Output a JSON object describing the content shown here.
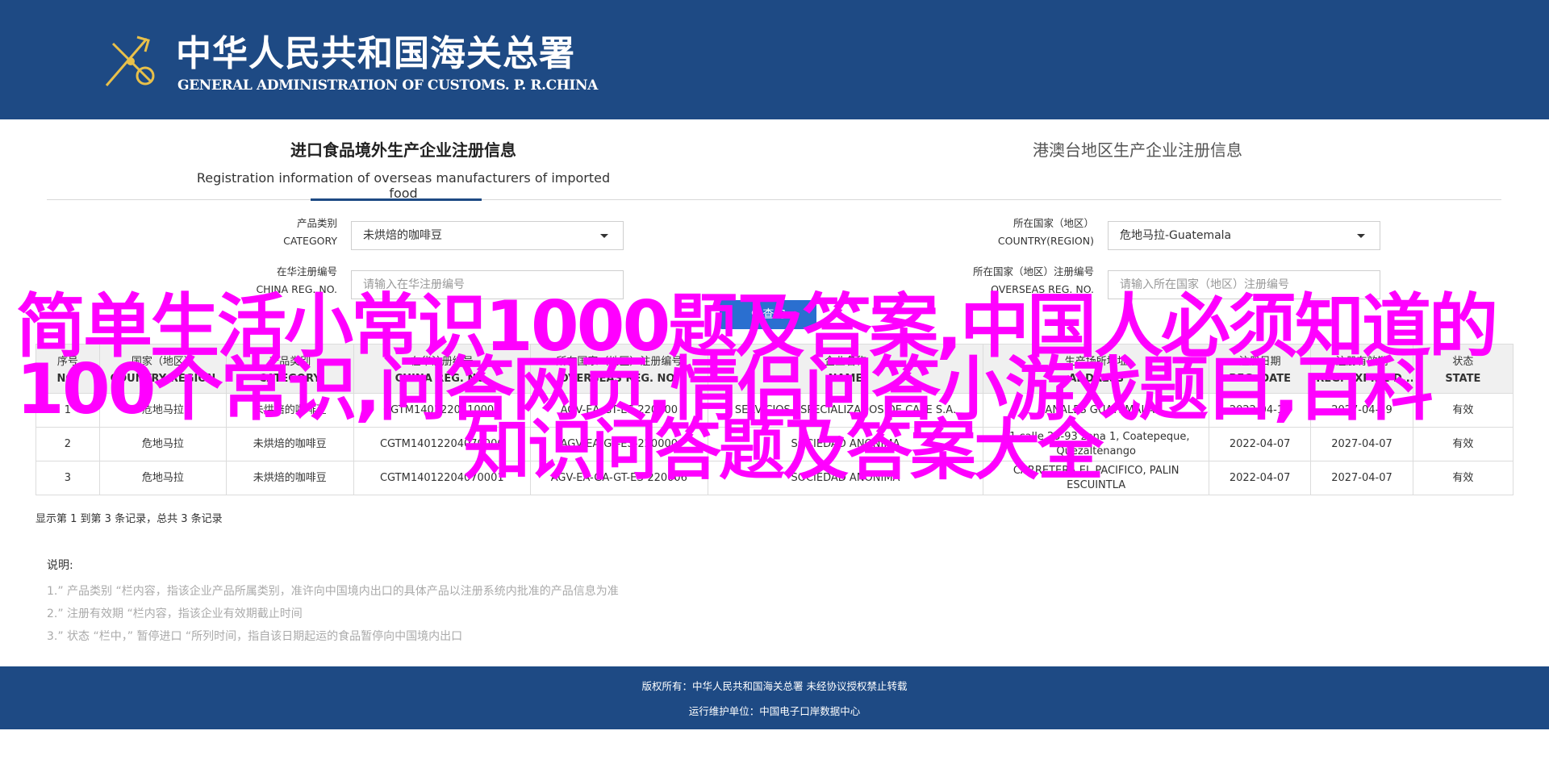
{
  "header": {
    "title_cn": "中华人民共和国海关总署",
    "title_en": "GENERAL ADMINISTRATION OF CUSTOMS. P. R.CHINA"
  },
  "tabs": {
    "active_cn": "进口食品境外生产企业注册信息",
    "active_en": "Registration information of overseas manufacturers of imported food",
    "other_cn": "港澳台地区生产企业注册信息"
  },
  "filters": {
    "category_label_cn": "产品类别",
    "category_label_en": "CATEGORY",
    "category_value": "未烘焙的咖啡豆",
    "country_label_cn": "所在国家（地区）",
    "country_label_en": "COUNTRY(REGION)",
    "country_value": "危地马拉-Guatemala",
    "china_reg_label_cn": "在华注册编号",
    "china_reg_label_en": "CHINA REG. NO.",
    "china_reg_placeholder": "请输入在华注册编号",
    "overseas_reg_label_cn": "所在国家（地区）注册编号",
    "overseas_reg_label_en": "OVERSEAS REG. NO.",
    "overseas_reg_placeholder": "请输入所在国家（地区）注册编号",
    "search_label": "查询"
  },
  "table": {
    "headers": [
      {
        "cn": "序号",
        "en": "NO."
      },
      {
        "cn": "国家（地区）",
        "en": "COUNTRY/REGION"
      },
      {
        "cn": "产品类别",
        "en": "CATEGORY"
      },
      {
        "cn": "在华注册编号",
        "en": "CHINA REG. NO."
      },
      {
        "cn": "所在国家（地区）注册编号",
        "en": "OVERSEAS REG. NO."
      },
      {
        "cn": "企业名称",
        "en": "NAME"
      },
      {
        "cn": "生产场所地址",
        "en": "ADDRESS"
      },
      {
        "cn": "注册日期",
        "en": "REG. DATE"
      },
      {
        "cn": "注册有效期",
        "en": "REG. EXPIRE D..."
      },
      {
        "cn": "状态",
        "en": "STATE"
      }
    ],
    "rows": [
      [
        "1",
        "危地马拉",
        "未烘焙的咖啡豆",
        "CGTM1401220410000",
        "AGV-EA-GT-ES-220000",
        "SERVICIOS ESPECIALIZADOS DE CAFE S.A.",
        "CANALES GUATEMALA",
        "2022-04-19",
        "2027-04-19",
        "有效"
      ],
      [
        "2",
        "危地马拉",
        "未烘焙的咖啡豆",
        "CGTM14012204070000",
        "AGV-EA-GT-ES-220000",
        "SOCIEDAD ANONIMA",
        "21 calle 25-93 zona 1, Coatepeque, Quezaltenango",
        "2022-04-07",
        "2027-04-07",
        "有效"
      ],
      [
        "3",
        "危地马拉",
        "未烘焙的咖啡豆",
        "CGTM14012204070001",
        "AGV-EA-GA-GT-ES-220006",
        "SOCIEDAD ANONIMA",
        "CARRETERA EL PACIFICO, PALIN ESCUINTLA",
        "2022-04-07",
        "2027-04-07",
        "有效"
      ]
    ]
  },
  "count_text": "显示第 1 到第 3 条记录，总共 3 条记录",
  "notes": {
    "title": "说明:",
    "items": [
      "1.” 产品类别 “栏内容，指该企业产品所属类别，准许向中国境内出口的具体产品以注册系统内批准的产品信息为准",
      "2.” 注册有效期 “栏内容，指该企业有效期截止时间",
      "3.” 状态 “栏中，” 暂停进口 “所列时间，指自该日期起运的食品暂停向中国境内出口"
    ]
  },
  "footer": {
    "line1": "版权所有：中华人民共和国海关总署 未经协议授权禁止转载",
    "line2": "运行维护单位：中国电子口岸数据中心"
  },
  "overlay": {
    "line1": "简单生活小常识1000题及答案,中国人必须知道的",
    "line2": "100个常识,问答网页,情侣问答小游戏题目,百科",
    "line3": "知识问答题及答案大全"
  },
  "colors": {
    "header_bg": "#1e4a84",
    "overlay_text": "#ff00ff",
    "button_bg": "#2a6fd0"
  },
  "icons": {
    "emblem": "customs-emblem-icon",
    "search": "search-icon",
    "caret": "chevron-down-icon"
  }
}
